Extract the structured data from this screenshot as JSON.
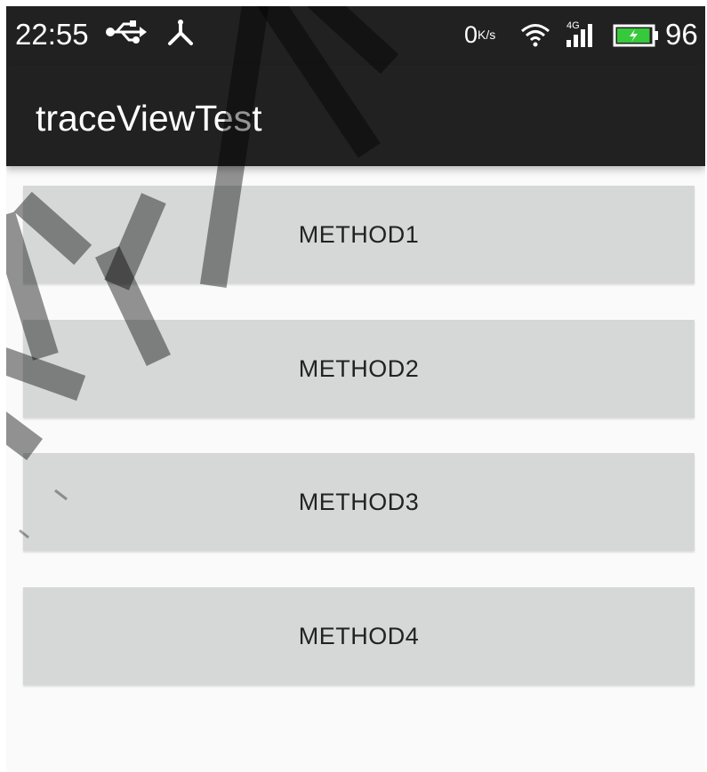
{
  "status_bar": {
    "time": "22:55",
    "net_speed_value": "0",
    "net_speed_unit": "K/s",
    "signal_label": "4G",
    "battery_level": "96",
    "battery_color": "#36c93b",
    "icons": [
      "usb-icon",
      "debug-icon",
      "wifi-icon",
      "signal-icon",
      "battery-icon"
    ]
  },
  "app_bar": {
    "title": "traceViewTest",
    "background": "#212121"
  },
  "buttons": [
    {
      "label": "METHOD1"
    },
    {
      "label": "METHOD2"
    },
    {
      "label": "METHOD3"
    },
    {
      "label": "METHOD4"
    }
  ]
}
